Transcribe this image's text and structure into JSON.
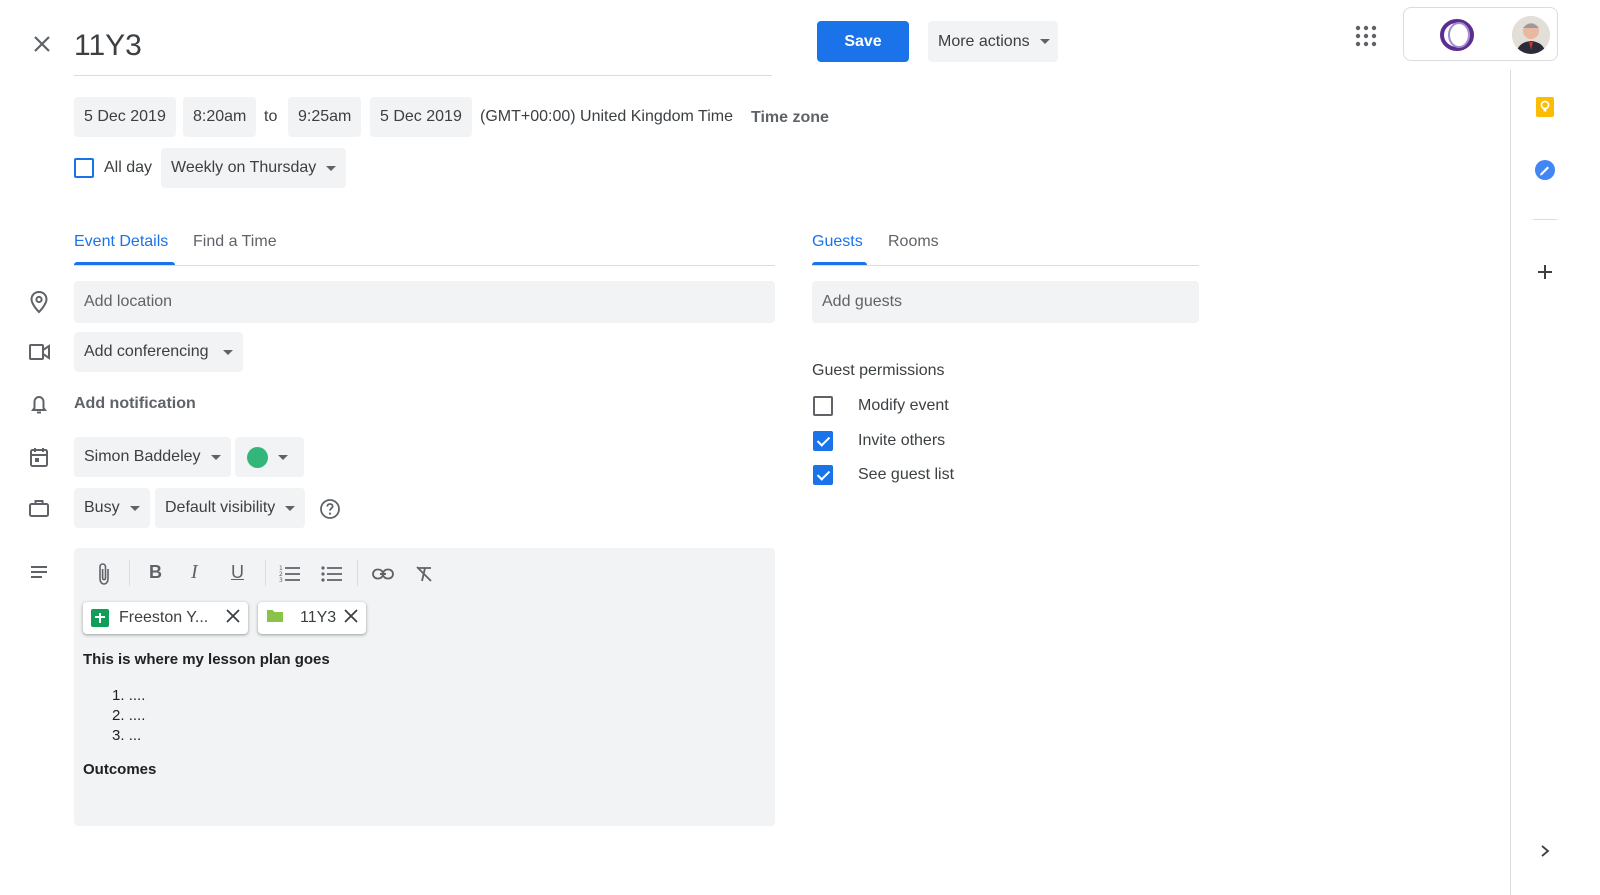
{
  "header": {
    "title": "11Y3",
    "save_label": "Save",
    "more_actions_label": "More actions"
  },
  "datetime": {
    "start_date": "5 Dec 2019",
    "start_time": "8:20am",
    "to_label": "to",
    "end_time": "9:25am",
    "end_date": "5 Dec 2019",
    "timezone": "(GMT+00:00) United Kingdom Time",
    "timezone_link": "Time zone",
    "all_day_label": "All day",
    "all_day_checked": false,
    "recurrence": "Weekly on Thursday"
  },
  "left_tabs": [
    {
      "label": "Event Details",
      "active": true
    },
    {
      "label": "Find a Time",
      "active": false
    }
  ],
  "details": {
    "location_placeholder": "Add location",
    "conferencing_label": "Add conferencing",
    "notification_label": "Add notification",
    "calendar_owner": "Simon Baddeley",
    "event_color": "#33b679",
    "availability": "Busy",
    "visibility": "Default visibility"
  },
  "description": {
    "attachments": [
      {
        "name": "Freeston Y...",
        "icon": "sheets-icon"
      },
      {
        "name": "11Y3",
        "icon": "folder-icon"
      }
    ],
    "heading": "This is where my lesson plan goes",
    "list_items": [
      "....",
      "....",
      "..."
    ],
    "outcomes": "Outcomes"
  },
  "right_tabs": [
    {
      "label": "Guests",
      "active": true
    },
    {
      "label": "Rooms",
      "active": false
    }
  ],
  "guests": {
    "placeholder": "Add guests",
    "permissions_title": "Guest permissions",
    "permissions": [
      {
        "label": "Modify event",
        "checked": false
      },
      {
        "label": "Invite others",
        "checked": true
      },
      {
        "label": "See guest list",
        "checked": true
      }
    ]
  },
  "colors": {
    "accent": "#1a73e8",
    "keep_yellow": "#fbbc04",
    "sheets_green": "#0f9d58",
    "folder_green": "#8bc34a"
  }
}
